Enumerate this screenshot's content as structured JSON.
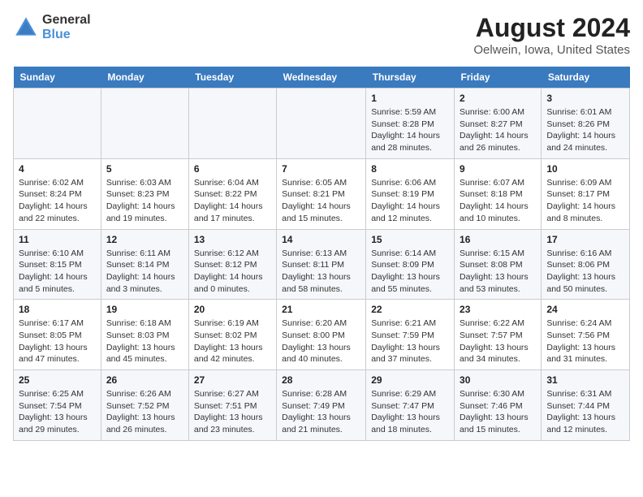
{
  "app": {
    "name_general": "General",
    "name_blue": "Blue"
  },
  "title": "August 2024",
  "subtitle": "Oelwein, Iowa, United States",
  "days_of_week": [
    "Sunday",
    "Monday",
    "Tuesday",
    "Wednesday",
    "Thursday",
    "Friday",
    "Saturday"
  ],
  "weeks": [
    [
      {
        "day": "",
        "detail": ""
      },
      {
        "day": "",
        "detail": ""
      },
      {
        "day": "",
        "detail": ""
      },
      {
        "day": "",
        "detail": ""
      },
      {
        "day": "1",
        "detail": "Sunrise: 5:59 AM\nSunset: 8:28 PM\nDaylight: 14 hours and 28 minutes."
      },
      {
        "day": "2",
        "detail": "Sunrise: 6:00 AM\nSunset: 8:27 PM\nDaylight: 14 hours and 26 minutes."
      },
      {
        "day": "3",
        "detail": "Sunrise: 6:01 AM\nSunset: 8:26 PM\nDaylight: 14 hours and 24 minutes."
      }
    ],
    [
      {
        "day": "4",
        "detail": "Sunrise: 6:02 AM\nSunset: 8:24 PM\nDaylight: 14 hours and 22 minutes."
      },
      {
        "day": "5",
        "detail": "Sunrise: 6:03 AM\nSunset: 8:23 PM\nDaylight: 14 hours and 19 minutes."
      },
      {
        "day": "6",
        "detail": "Sunrise: 6:04 AM\nSunset: 8:22 PM\nDaylight: 14 hours and 17 minutes."
      },
      {
        "day": "7",
        "detail": "Sunrise: 6:05 AM\nSunset: 8:21 PM\nDaylight: 14 hours and 15 minutes."
      },
      {
        "day": "8",
        "detail": "Sunrise: 6:06 AM\nSunset: 8:19 PM\nDaylight: 14 hours and 12 minutes."
      },
      {
        "day": "9",
        "detail": "Sunrise: 6:07 AM\nSunset: 8:18 PM\nDaylight: 14 hours and 10 minutes."
      },
      {
        "day": "10",
        "detail": "Sunrise: 6:09 AM\nSunset: 8:17 PM\nDaylight: 14 hours and 8 minutes."
      }
    ],
    [
      {
        "day": "11",
        "detail": "Sunrise: 6:10 AM\nSunset: 8:15 PM\nDaylight: 14 hours and 5 minutes."
      },
      {
        "day": "12",
        "detail": "Sunrise: 6:11 AM\nSunset: 8:14 PM\nDaylight: 14 hours and 3 minutes."
      },
      {
        "day": "13",
        "detail": "Sunrise: 6:12 AM\nSunset: 8:12 PM\nDaylight: 14 hours and 0 minutes."
      },
      {
        "day": "14",
        "detail": "Sunrise: 6:13 AM\nSunset: 8:11 PM\nDaylight: 13 hours and 58 minutes."
      },
      {
        "day": "15",
        "detail": "Sunrise: 6:14 AM\nSunset: 8:09 PM\nDaylight: 13 hours and 55 minutes."
      },
      {
        "day": "16",
        "detail": "Sunrise: 6:15 AM\nSunset: 8:08 PM\nDaylight: 13 hours and 53 minutes."
      },
      {
        "day": "17",
        "detail": "Sunrise: 6:16 AM\nSunset: 8:06 PM\nDaylight: 13 hours and 50 minutes."
      }
    ],
    [
      {
        "day": "18",
        "detail": "Sunrise: 6:17 AM\nSunset: 8:05 PM\nDaylight: 13 hours and 47 minutes."
      },
      {
        "day": "19",
        "detail": "Sunrise: 6:18 AM\nSunset: 8:03 PM\nDaylight: 13 hours and 45 minutes."
      },
      {
        "day": "20",
        "detail": "Sunrise: 6:19 AM\nSunset: 8:02 PM\nDaylight: 13 hours and 42 minutes."
      },
      {
        "day": "21",
        "detail": "Sunrise: 6:20 AM\nSunset: 8:00 PM\nDaylight: 13 hours and 40 minutes."
      },
      {
        "day": "22",
        "detail": "Sunrise: 6:21 AM\nSunset: 7:59 PM\nDaylight: 13 hours and 37 minutes."
      },
      {
        "day": "23",
        "detail": "Sunrise: 6:22 AM\nSunset: 7:57 PM\nDaylight: 13 hours and 34 minutes."
      },
      {
        "day": "24",
        "detail": "Sunrise: 6:24 AM\nSunset: 7:56 PM\nDaylight: 13 hours and 31 minutes."
      }
    ],
    [
      {
        "day": "25",
        "detail": "Sunrise: 6:25 AM\nSunset: 7:54 PM\nDaylight: 13 hours and 29 minutes."
      },
      {
        "day": "26",
        "detail": "Sunrise: 6:26 AM\nSunset: 7:52 PM\nDaylight: 13 hours and 26 minutes."
      },
      {
        "day": "27",
        "detail": "Sunrise: 6:27 AM\nSunset: 7:51 PM\nDaylight: 13 hours and 23 minutes."
      },
      {
        "day": "28",
        "detail": "Sunrise: 6:28 AM\nSunset: 7:49 PM\nDaylight: 13 hours and 21 minutes."
      },
      {
        "day": "29",
        "detail": "Sunrise: 6:29 AM\nSunset: 7:47 PM\nDaylight: 13 hours and 18 minutes."
      },
      {
        "day": "30",
        "detail": "Sunrise: 6:30 AM\nSunset: 7:46 PM\nDaylight: 13 hours and 15 minutes."
      },
      {
        "day": "31",
        "detail": "Sunrise: 6:31 AM\nSunset: 7:44 PM\nDaylight: 13 hours and 12 minutes."
      }
    ]
  ]
}
